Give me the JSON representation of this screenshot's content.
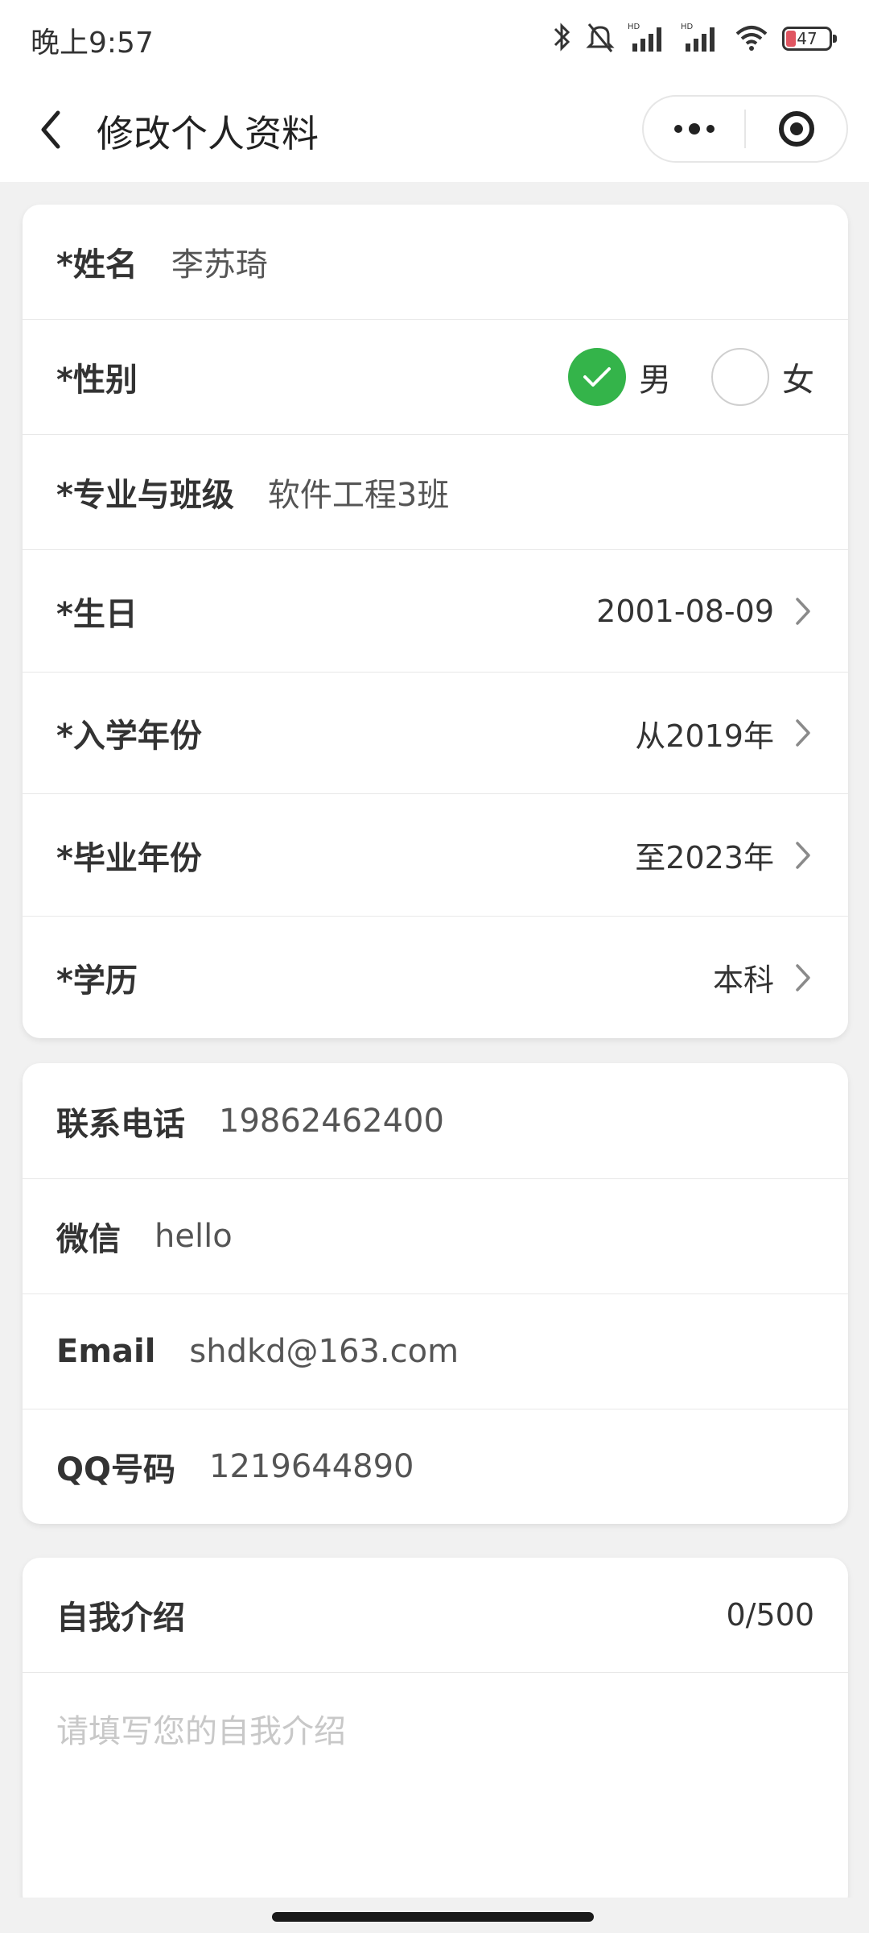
{
  "status_bar": {
    "time": "晚上9:57",
    "battery_level": "47",
    "icons": [
      "bluetooth-icon",
      "mute-bell-icon",
      "signal-hd-icon",
      "signal-hd-icon",
      "wifi-icon",
      "battery-icon"
    ]
  },
  "nav": {
    "title": "修改个人资料",
    "back_icon": "chevron-left-icon",
    "more_icon": "more-dots-icon",
    "close_icon": "target-icon"
  },
  "basic_info": {
    "name_label": "*姓名",
    "name_value": "李苏琦",
    "gender_label": "*性别",
    "gender_options": [
      "男",
      "女"
    ],
    "gender_selected": "男",
    "major_label": "*专业与班级",
    "major_value": "软件工程3班",
    "birthday_label": "*生日",
    "birthday_value": "2001-08-09",
    "enroll_label": "*入学年份",
    "enroll_value": "从2019年",
    "grad_label": "*毕业年份",
    "grad_value": "至2023年",
    "edu_label": "*学历",
    "edu_value": "本科"
  },
  "contact": {
    "phone_label": "联系电话",
    "phone_value": "19862462400",
    "wechat_label": "微信",
    "wechat_value": "hello",
    "email_label": "Email",
    "email_value": "shdkd@163.com",
    "qq_label": "QQ号码",
    "qq_value": "1219644890"
  },
  "intro": {
    "label": "自我介绍",
    "counter": "0/500",
    "placeholder": "请填写您的自我介绍"
  },
  "colors": {
    "accent_green": "#34b44a",
    "background": "#f1f1f1",
    "card": "#ffffff"
  }
}
